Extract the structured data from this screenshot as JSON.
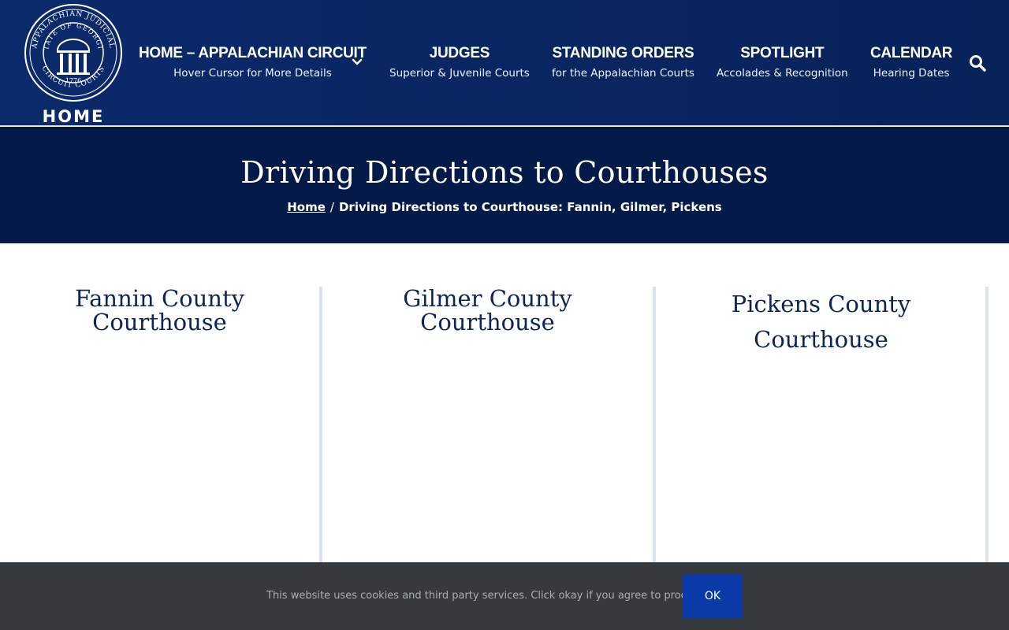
{
  "header": {
    "logo": {
      "seal_text_top": "APPALACHIAN JUDICIAL",
      "seal_text_state": "STATE OF GEORGIA",
      "seal_text_bottom": "CIRCUIT COURTS",
      "seal_year": "1776",
      "label": "HOME"
    },
    "nav": [
      {
        "title": "HOME – APPALACHIAN CIRCUIT",
        "sub": "Hover Cursor for More Details",
        "has_dropdown": true
      },
      {
        "title": "JUDGES",
        "sub": "Superior & Juvenile Courts"
      },
      {
        "title": "STANDING ORDERS",
        "sub": "for the Appalachian Courts"
      },
      {
        "title": "SPOTLIGHT",
        "sub": "Accolades & Recognition"
      },
      {
        "title": "CALENDAR",
        "sub": "Hearing Dates"
      }
    ],
    "search_icon": "search-icon",
    "chevron_icon": "chevron-down-icon"
  },
  "title_band": {
    "title": "Driving Directions to Courthouses",
    "breadcrumb_home": "Home",
    "breadcrumb_sep": "/",
    "breadcrumb_current": "Driving Directions to Courthouse: Fannin, Gilmer, Pickens"
  },
  "columns": [
    {
      "title": "Fannin County Courthouse"
    },
    {
      "title": "Gilmer County Courthouse"
    },
    {
      "title": "Pickens County Courthouse"
    }
  ],
  "cookie_bar": {
    "text": "This website uses cookies and third party services. Click okay if you agree to proceed.",
    "button_label": "OK"
  },
  "colors": {
    "header_bg": "#0a2662",
    "band_bg": "#041a48",
    "heading_text": "#0b2555",
    "cookie_bg": "#363a3d",
    "cookie_button": "#0a3aa8"
  }
}
